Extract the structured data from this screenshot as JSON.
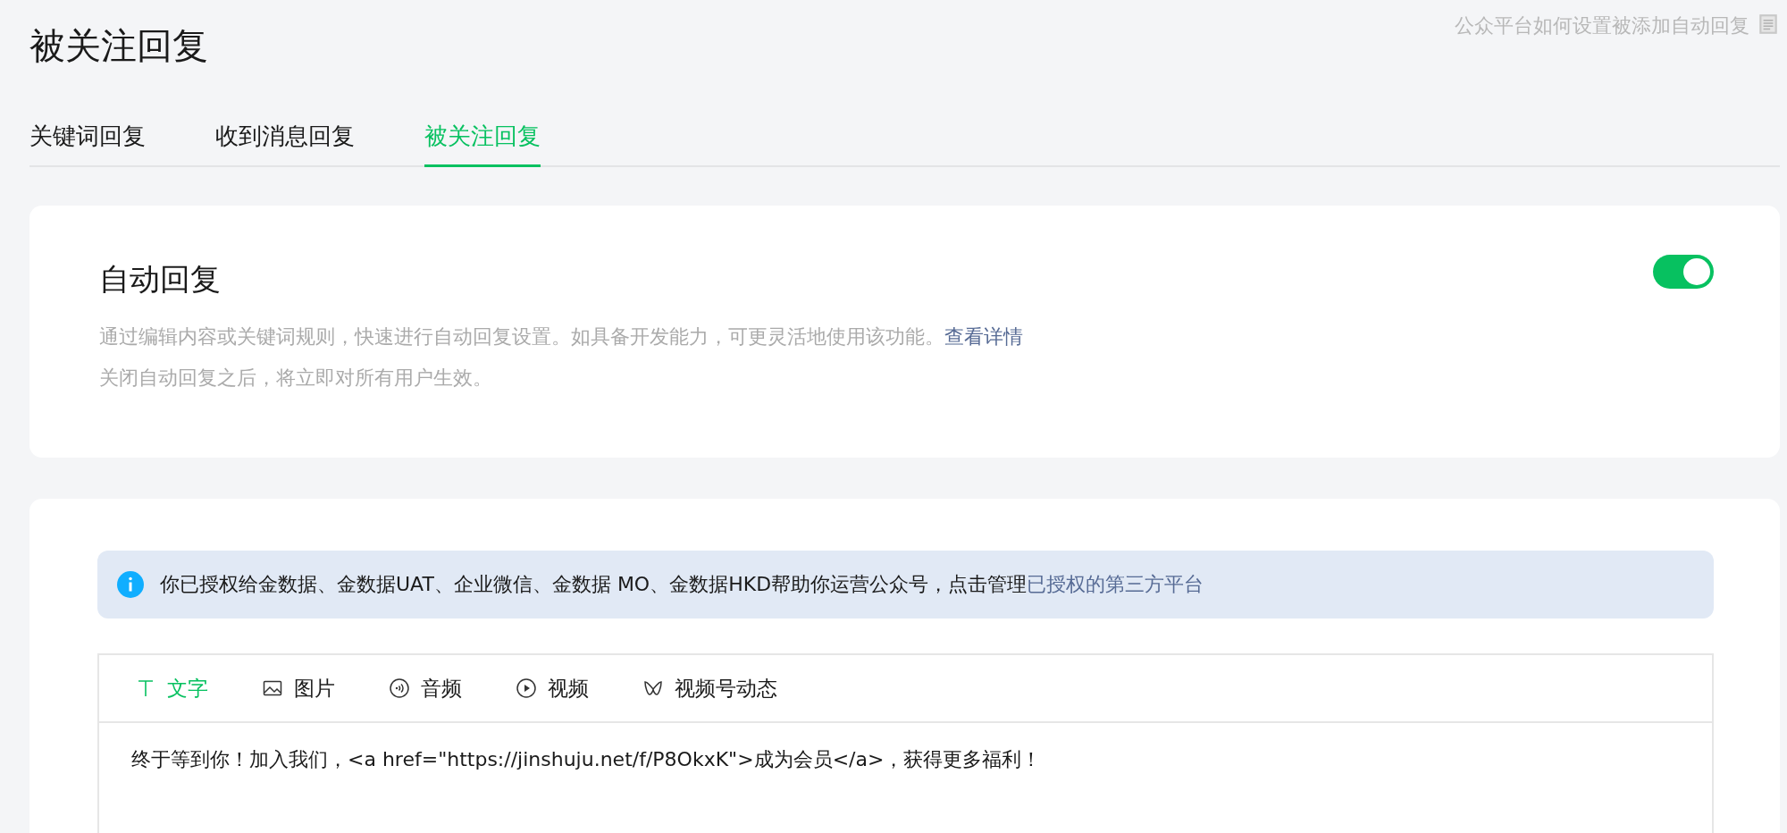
{
  "page": {
    "title": "被关注回复",
    "help_link": "公众平台如何设置被添加自动回复"
  },
  "tabs": [
    {
      "label": "关键词回复",
      "selected": false
    },
    {
      "label": "收到消息回复",
      "selected": false
    },
    {
      "label": "被关注回复",
      "selected": true
    }
  ],
  "auto_reply": {
    "title": "自动回复",
    "on": true,
    "description": "通过编辑内容或关键词规则，快速进行自动回复设置。如具备开发能力，可更灵活地使用该功能。",
    "details_link": "查看详情",
    "note": "关闭自动回复之后，将立即对所有用户生效。"
  },
  "notice": {
    "text": "你已授权给金数据、金数据UAT、企业微信、金数据 MO、金数据HKD帮助你运营公众号，点击管理",
    "link": "已授权的第三方平台"
  },
  "editor": {
    "types": [
      {
        "kind": "text",
        "label": "文字",
        "selected": true
      },
      {
        "kind": "image",
        "label": "图片",
        "selected": false
      },
      {
        "kind": "audio",
        "label": "音频",
        "selected": false
      },
      {
        "kind": "video",
        "label": "视频",
        "selected": false
      },
      {
        "kind": "channels",
        "label": "视频号动态",
        "selected": false
      }
    ],
    "content": "终于等到你！加入我们，<a href=\"https://jinshuju.net/f/P8OkxK\">成为会员</a>，获得更多福利！"
  }
}
